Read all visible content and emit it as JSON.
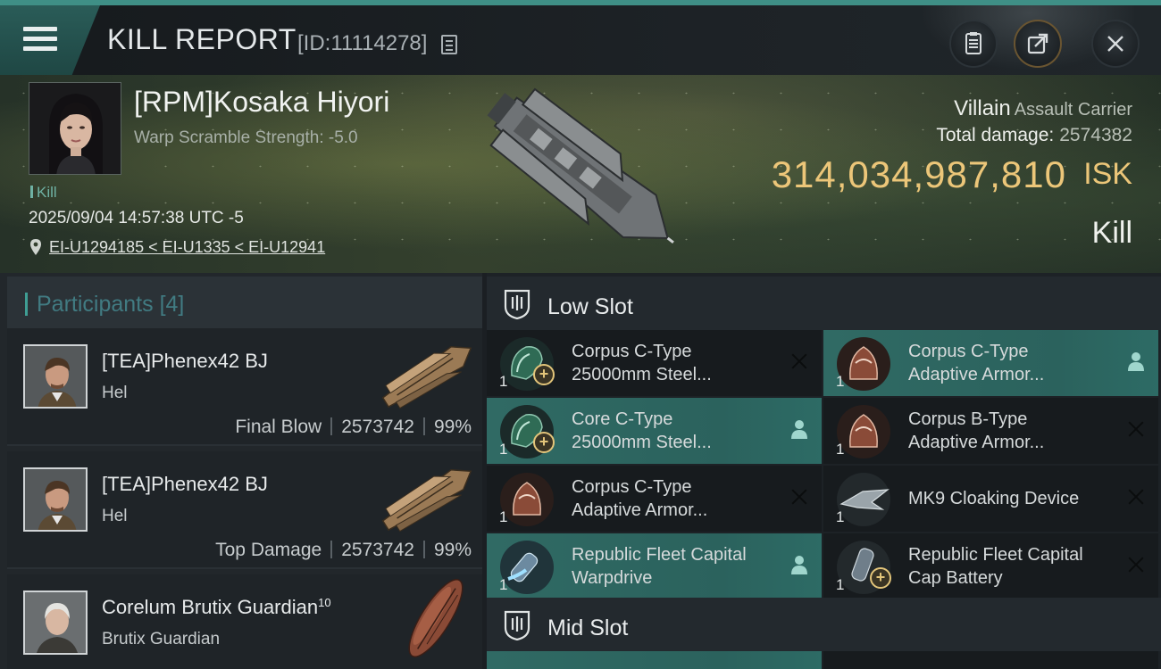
{
  "header": {
    "title": "KILL REPORT",
    "report_id": "[ID:11114278]",
    "icons": [
      "menu-icon",
      "copy-icon",
      "clipboard-icon",
      "share-icon",
      "close-icon"
    ]
  },
  "victim": {
    "name": "[RPM]Kosaka Hiyori",
    "warp_scramble": "Warp Scramble Strength: -5.0",
    "tag": "Kill",
    "date": "2025/09/04 14:57:38 UTC -5",
    "location": "EI-U1294185 < EI-U1335 < EI-U12941",
    "ship_name": "Villain",
    "ship_class": "Assault Carrier",
    "total_damage_label": "Total damage:",
    "total_damage_value": "2574382",
    "isk_value": "314,034,987,810",
    "isk_unit": "ISK",
    "result": "Kill"
  },
  "participants": {
    "title": "Participants",
    "count": "[4]",
    "list": [
      {
        "name": "[TEA]Phenex42 BJ",
        "ship": "Hel",
        "role": "Final Blow",
        "damage": "2573742",
        "percent": "99%"
      },
      {
        "name": "[TEA]Phenex42 BJ",
        "ship": "Hel",
        "role": "Top Damage",
        "damage": "2573742",
        "percent": "99%"
      },
      {
        "name": "Corelum Brutix Guardian",
        "level": "10",
        "ship": "Brutix Guardian"
      }
    ]
  },
  "fitting": {
    "low_slot_title": "Low Slot",
    "mid_slot_title": "Mid Slot",
    "low_modules": [
      {
        "line1": "Corpus C-Type",
        "line2": "25000mm Steel...",
        "qty": "1",
        "status": "destroyed",
        "highlight": false,
        "icon": "armor-plate-icon"
      },
      {
        "line1": "Corpus C-Type",
        "line2": "Adaptive Armor...",
        "qty": "1",
        "status": "dropped",
        "highlight": true,
        "icon": "adaptive-armor-icon"
      },
      {
        "line1": "Core C-Type",
        "line2": "25000mm Steel...",
        "qty": "1",
        "status": "dropped",
        "highlight": true,
        "icon": "armor-plate-icon"
      },
      {
        "line1": "Corpus B-Type",
        "line2": "Adaptive Armor...",
        "qty": "1",
        "status": "destroyed",
        "highlight": false,
        "icon": "adaptive-armor-icon"
      },
      {
        "line1": "Corpus C-Type",
        "line2": "Adaptive Armor...",
        "qty": "1",
        "status": "destroyed",
        "highlight": false,
        "icon": "adaptive-armor-icon"
      },
      {
        "line1": "MK9 Cloaking Device",
        "line2": "",
        "qty": "1",
        "status": "destroyed",
        "highlight": false,
        "icon": "cloak-icon"
      },
      {
        "line1": "Republic Fleet Capital",
        "line2": "Warpdrive",
        "qty": "1",
        "status": "dropped",
        "highlight": true,
        "icon": "warpdrive-icon"
      },
      {
        "line1": "Republic Fleet Capital",
        "line2": "Cap Battery",
        "qty": "1",
        "status": "destroyed",
        "highlight": false,
        "icon": "cap-battery-icon"
      }
    ]
  },
  "colors": {
    "accent_teal": "#3f8f86",
    "isk_gold": "#ecc679",
    "dropped_row": "#2b625d"
  }
}
